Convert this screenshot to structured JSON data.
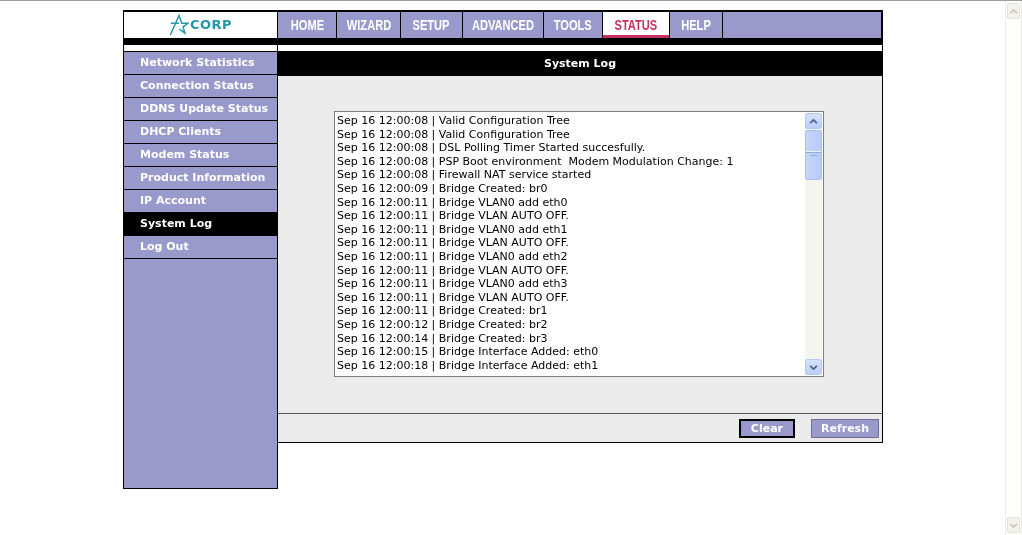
{
  "logo": {
    "text": "CORP"
  },
  "nav_tabs": [
    {
      "label": "HOME",
      "selected": false
    },
    {
      "label": "WIZARD",
      "selected": false
    },
    {
      "label": "SETUP",
      "selected": false
    },
    {
      "label": "ADVANCED",
      "selected": false
    },
    {
      "label": "TOOLS",
      "selected": false
    },
    {
      "label": "STATUS",
      "selected": true
    },
    {
      "label": "HELP",
      "selected": false
    }
  ],
  "sidebar": {
    "items": [
      {
        "label": "Network Statistics",
        "selected": false
      },
      {
        "label": "Connection Status",
        "selected": false
      },
      {
        "label": "DDNS Update Status",
        "selected": false
      },
      {
        "label": "DHCP Clients",
        "selected": false
      },
      {
        "label": "Modem Status",
        "selected": false
      },
      {
        "label": "Product Information",
        "selected": false
      },
      {
        "label": "IP Account",
        "selected": false
      },
      {
        "label": "System Log",
        "selected": true
      },
      {
        "label": "Log Out",
        "selected": false
      }
    ]
  },
  "panel": {
    "title": "System Log",
    "log_lines": [
      "Sep 16 12:00:08 | Valid Configuration Tree",
      "Sep 16 12:00:08 | Valid Configuration Tree",
      "Sep 16 12:00:08 | DSL Polling Timer Started succesfully.",
      "Sep 16 12:00:08 | PSP Boot environment  Modem Modulation Change: 1",
      "Sep 16 12:00:08 | Firewall NAT service started",
      "Sep 16 12:00:09 | Bridge Created: br0",
      "Sep 16 12:00:11 | Bridge VLAN0 add eth0",
      "Sep 16 12:00:11 | Bridge VLAN AUTO OFF.",
      "Sep 16 12:00:11 | Bridge VLAN0 add eth1",
      "Sep 16 12:00:11 | Bridge VLAN AUTO OFF.",
      "Sep 16 12:00:11 | Bridge VLAN0 add eth2",
      "Sep 16 12:00:11 | Bridge VLAN AUTO OFF.",
      "Sep 16 12:00:11 | Bridge VLAN0 add eth3",
      "Sep 16 12:00:11 | Bridge VLAN AUTO OFF.",
      "Sep 16 12:00:11 | Bridge Created: br1",
      "Sep 16 12:00:12 | Bridge Created: br2",
      "Sep 16 12:00:14 | Bridge Created: br3",
      "Sep 16 12:00:15 | Bridge Interface Added: eth0",
      "Sep 16 12:00:18 | Bridge Interface Added: eth1"
    ]
  },
  "buttons": [
    {
      "label": "Clear",
      "default": true
    },
    {
      "label": "Refresh",
      "default": false
    }
  ]
}
